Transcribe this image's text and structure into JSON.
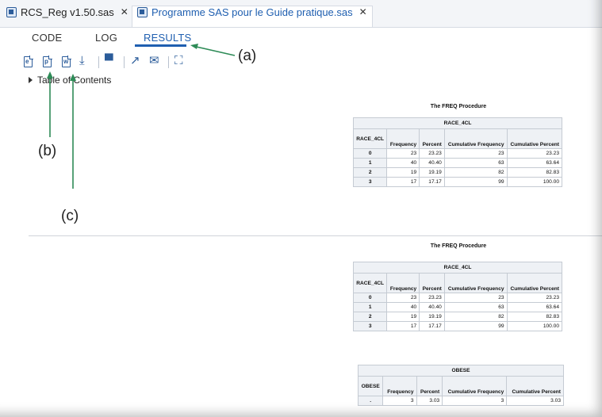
{
  "tabs": [
    {
      "title": "RCS_Reg v1.50.sas",
      "close": "✕"
    },
    {
      "title": "Programme SAS pour le Guide pratique.sas",
      "close": "✕"
    }
  ],
  "subtabs": [
    "CODE",
    "LOG",
    "RESULTS"
  ],
  "toolbar": {
    "icons": [
      "html-doc-icon",
      "pdf-doc-icon",
      "rtf-doc-icon",
      "download-icon",
      "print-icon",
      "expand-icon",
      "email-icon",
      "fullscreen-icon"
    ]
  },
  "toc_label": "Table of Contents",
  "proc_title": "The FREQ Procedure",
  "table1": {
    "var": "RACE_4CL",
    "columns": [
      "RACE_4CL",
      "Frequency",
      "Percent",
      "Cumulative Frequency",
      "Cumulative Percent"
    ],
    "rows": [
      [
        "0",
        "23",
        "23.23",
        "23",
        "23.23"
      ],
      [
        "1",
        "40",
        "40.40",
        "63",
        "63.64"
      ],
      [
        "2",
        "19",
        "19.19",
        "82",
        "82.83"
      ],
      [
        "3",
        "17",
        "17.17",
        "99",
        "100.00"
      ]
    ]
  },
  "table2": {
    "var": "RACE_4CL",
    "columns": [
      "RACE_4CL",
      "Frequency",
      "Percent",
      "Cumulative Frequency",
      "Cumulative Percent"
    ],
    "rows": [
      [
        "0",
        "23",
        "23.23",
        "23",
        "23.23"
      ],
      [
        "1",
        "40",
        "40.40",
        "63",
        "63.64"
      ],
      [
        "2",
        "19",
        "19.19",
        "82",
        "82.83"
      ],
      [
        "3",
        "17",
        "17.17",
        "99",
        "100.00"
      ]
    ]
  },
  "table3": {
    "var": "OBESE",
    "columns": [
      "OBESE",
      "Frequency",
      "Percent",
      "Cumulative Frequency",
      "Cumulative Percent"
    ],
    "rows": [
      [
        ".",
        "3",
        "3.03",
        "3",
        "3.03"
      ]
    ]
  },
  "annotations": {
    "a": "(a)",
    "b": "(b)",
    "c": "(c)"
  },
  "colors": {
    "accent": "#1f5fb0",
    "arrow": "#2e8b57"
  }
}
